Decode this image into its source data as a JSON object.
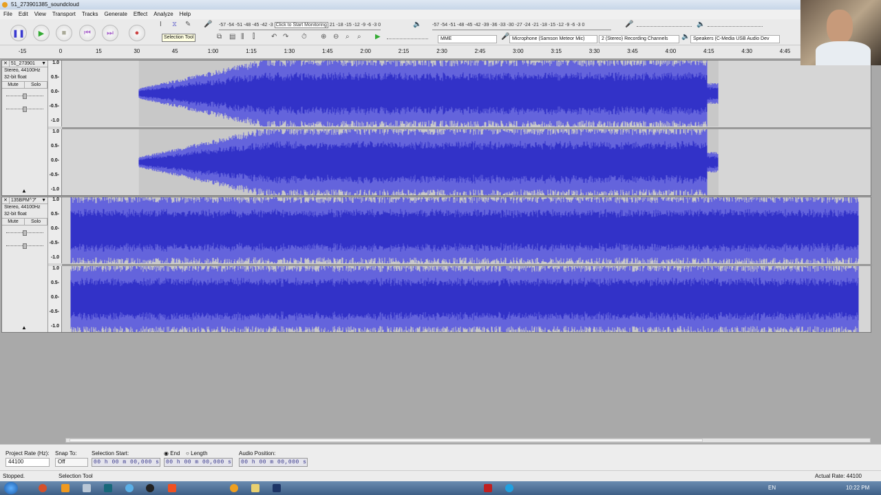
{
  "window": {
    "title": "51_273901385_soundcloud"
  },
  "menu": [
    "File",
    "Edit",
    "View",
    "Transport",
    "Tracks",
    "Generate",
    "Effect",
    "Analyze",
    "Help"
  ],
  "transport": {
    "pause": "pause-icon",
    "play": "play-icon",
    "stop": "stop-icon",
    "skip_start": "skip-start-icon",
    "skip_end": "skip-end-icon",
    "record": "record-icon"
  },
  "tooltip": "Selection Tool",
  "meters": {
    "record_scale": "-57 -54 -51 -48 -45 -42 -3",
    "record_monitor": "Click to Start Monitoring",
    "record_scale_end": "21 -18 -15 -12 -9 -6 -3 0",
    "playback_scale": "-57 -54 -51 -48 -45 -42 -39 -36 -33 -30 -27 -24 -21 -18 -15 -12 -9 -6 -3 0"
  },
  "devices": {
    "host": "MME",
    "input": "Microphone (Samson Meteor Mic)",
    "channels": "2 (Stereo) Recording Channels",
    "output": "Speakers (C-Media USB Audio Dev"
  },
  "ruler": [
    "-15",
    "0",
    "15",
    "30",
    "45",
    "1:00",
    "1:15",
    "1:30",
    "1:45",
    "2:00",
    "2:15",
    "2:30",
    "2:45",
    "3:00",
    "3:15",
    "3:30",
    "3:45",
    "4:00",
    "4:15",
    "4:30",
    "4:45"
  ],
  "tracks": [
    {
      "name": "51_273901",
      "format": "Stereo, 44100Hz",
      "depth": "32-bit float",
      "mute": "Mute",
      "solo": "Solo"
    },
    {
      "name": "135BPM^ア",
      "format": "Stereo, 44100Hz",
      "depth": "32-bit float",
      "mute": "Mute",
      "solo": "Solo"
    }
  ],
  "scale": [
    "1.0",
    "0.5-",
    "0.0-",
    "-0.5-",
    "-1.0"
  ],
  "colors": {
    "waveform": "#3232c8",
    "waveform_light": "#6464dc",
    "track_bg": "#d6d6d6"
  },
  "selection": {
    "project_rate_label": "Project Rate (Hz):",
    "project_rate": "44100",
    "snap_label": "Snap To:",
    "snap": "Off",
    "start_label": "Selection Start:",
    "end_label": "End",
    "length_label": "Length",
    "audio_pos_label": "Audio Position:",
    "start": "00 h 00 m 00,000 s",
    "end": "00 h 00 m 00,000 s",
    "audio_pos": "00 h 00 m 00,000 s"
  },
  "status": {
    "state": "Stopped.",
    "tool": "Selection Tool",
    "rate": "Actual Rate: 44100"
  },
  "taskbar": {
    "lang": "EN",
    "clock": "10:22 PM"
  }
}
